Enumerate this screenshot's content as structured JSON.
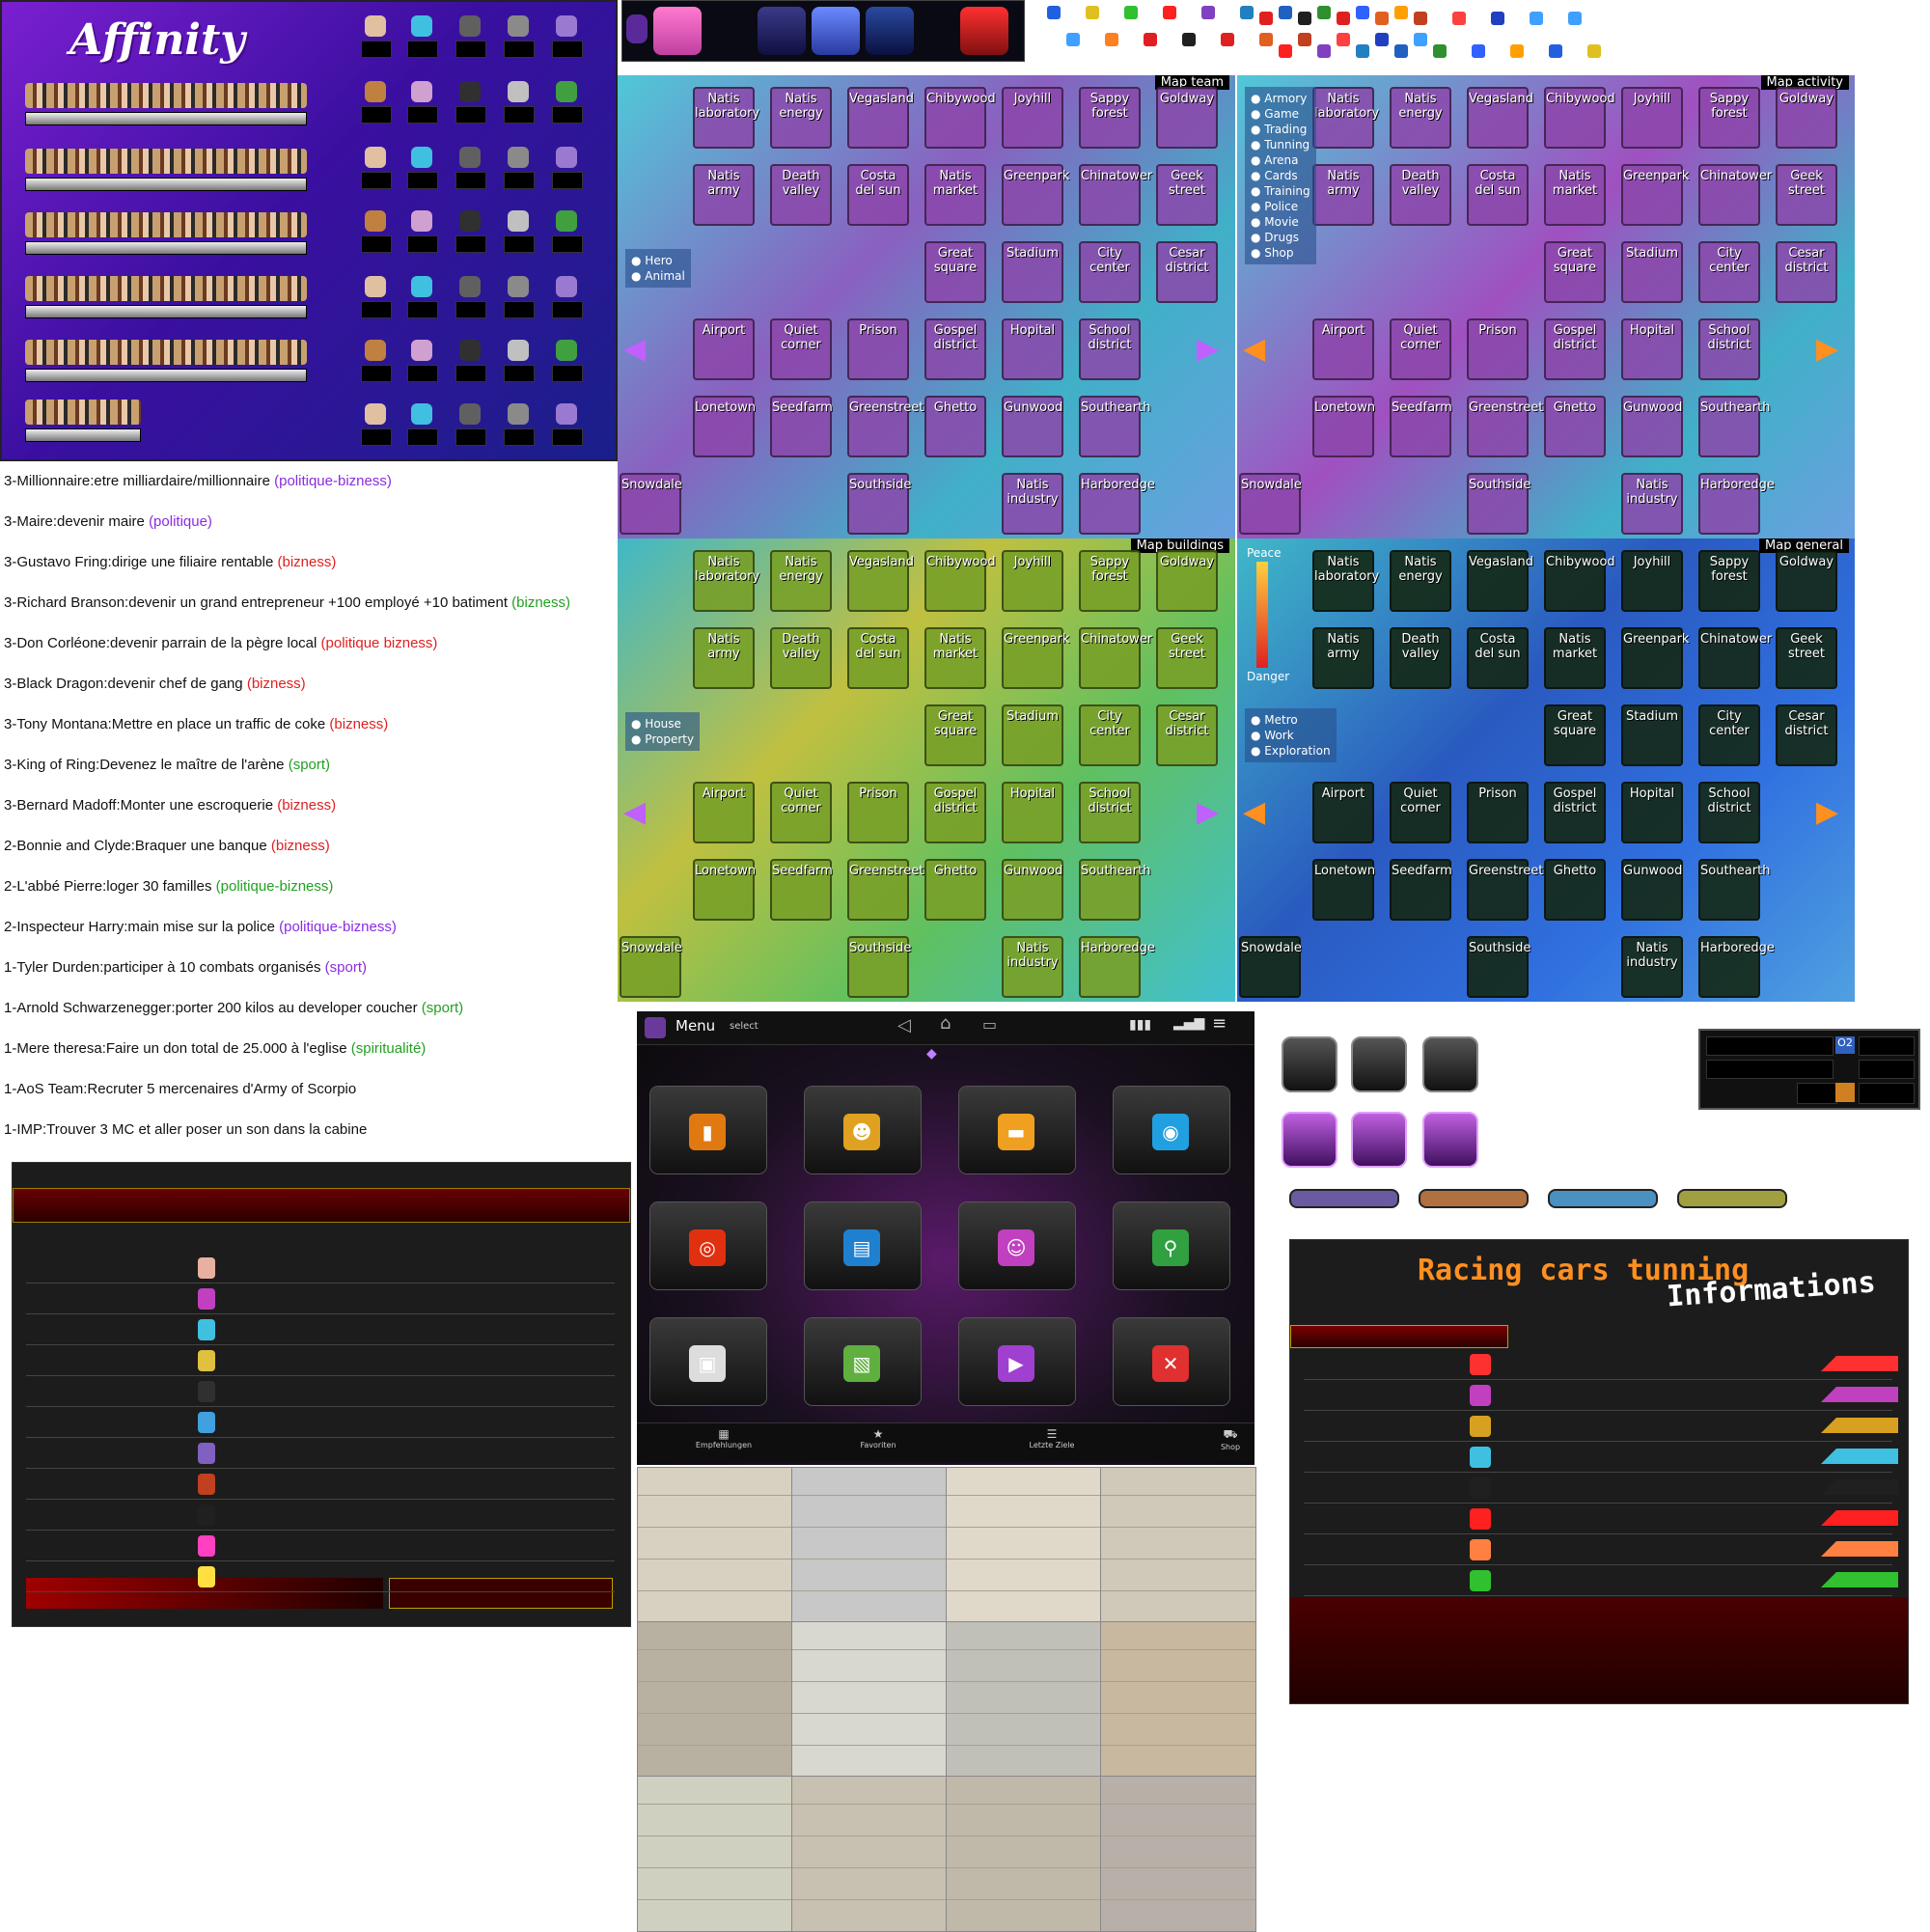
{
  "affinity": {
    "title": "Affinity"
  },
  "maps": [
    {
      "id": "team",
      "title": "Map team",
      "legend": [
        {
          "icon": "star-icon",
          "label": "Hero"
        },
        {
          "icon": "paw-icon",
          "label": "Animal"
        }
      ]
    },
    {
      "id": "activity",
      "title": "Map activity",
      "legend": [
        {
          "icon": "armory-icon",
          "label": "Armory"
        },
        {
          "icon": "gamepad-icon",
          "label": "Game"
        },
        {
          "icon": "dollar-icon",
          "label": "Trading"
        },
        {
          "icon": "gear-icon",
          "label": "Tunning"
        },
        {
          "icon": "arena-icon",
          "label": "Arena"
        },
        {
          "icon": "cards-icon",
          "label": "Cards"
        },
        {
          "icon": "training-icon",
          "label": "Training"
        },
        {
          "icon": "police-icon",
          "label": "Police"
        },
        {
          "icon": "movie-icon",
          "label": "Movie"
        },
        {
          "icon": "drugs-icon",
          "label": "Drugs"
        },
        {
          "icon": "shop-icon",
          "label": "Shop"
        }
      ]
    },
    {
      "id": "buildings",
      "title": "Map buildings",
      "legend": [
        {
          "icon": "house-icon",
          "label": "House"
        },
        {
          "icon": "dollar-icon",
          "label": "Property"
        }
      ]
    },
    {
      "id": "general",
      "title": "Map general",
      "legend": [
        {
          "icon": "star-icon",
          "label": "Metro"
        },
        {
          "icon": "work-icon",
          "label": "Work"
        },
        {
          "icon": "question-icon",
          "label": "Exploration"
        }
      ],
      "gauge": {
        "top": "Peace",
        "bottom": "Danger"
      }
    }
  ],
  "districts": [
    {
      "row": 0,
      "col": 0,
      "name": "Natis laboratory"
    },
    {
      "row": 0,
      "col": 1,
      "name": "Natis energy"
    },
    {
      "row": 0,
      "col": 2,
      "name": "Vegasland"
    },
    {
      "row": 0,
      "col": 3,
      "name": "Chibywood"
    },
    {
      "row": 0,
      "col": 4,
      "name": "Joyhill"
    },
    {
      "row": 0,
      "col": 5,
      "name": "Sappy forest"
    },
    {
      "row": 0,
      "col": 6,
      "name": "Goldway"
    },
    {
      "row": 1,
      "col": 0,
      "name": "Natis army"
    },
    {
      "row": 1,
      "col": 1,
      "name": "Death valley"
    },
    {
      "row": 1,
      "col": 2,
      "name": "Costa del sun"
    },
    {
      "row": 1,
      "col": 3,
      "name": "Natis market"
    },
    {
      "row": 1,
      "col": 4,
      "name": "Greenpark"
    },
    {
      "row": 1,
      "col": 5,
      "name": "Chinatower"
    },
    {
      "row": 1,
      "col": 6,
      "name": "Geek street"
    },
    {
      "row": 2,
      "col": 3,
      "name": "Great square"
    },
    {
      "row": 2,
      "col": 4,
      "name": "Stadium"
    },
    {
      "row": 2,
      "col": 5,
      "name": "City center"
    },
    {
      "row": 2,
      "col": 6,
      "name": "Cesar district"
    },
    {
      "row": 3,
      "col": 0,
      "name": "Airport"
    },
    {
      "row": 3,
      "col": 1,
      "name": "Quiet corner"
    },
    {
      "row": 3,
      "col": 2,
      "name": "Prison"
    },
    {
      "row": 3,
      "col": 3,
      "name": "Gospel district"
    },
    {
      "row": 3,
      "col": 4,
      "name": "Hopital"
    },
    {
      "row": 3,
      "col": 5,
      "name": "School district"
    },
    {
      "row": 4,
      "col": 0,
      "name": "Lonetown"
    },
    {
      "row": 4,
      "col": 1,
      "name": "Seedfarm"
    },
    {
      "row": 4,
      "col": 2,
      "name": "Greenstreet"
    },
    {
      "row": 4,
      "col": 3,
      "name": "Ghetto"
    },
    {
      "row": 4,
      "col": 4,
      "name": "Gunwood"
    },
    {
      "row": 4,
      "col": 5,
      "name": "Southearth"
    },
    {
      "row": 5,
      "col": -1,
      "name": "Snowdale"
    },
    {
      "row": 5,
      "col": 2,
      "name": "Southside"
    },
    {
      "row": 5,
      "col": 4,
      "name": "Natis industry"
    },
    {
      "row": 5,
      "col": 5,
      "name": "Harboredge"
    }
  ],
  "goals": [
    {
      "text": "3-Millionnaire:etre milliardaire/millionnaire ",
      "tag": "(politique-bizness)",
      "color": "#8a2be2"
    },
    {
      "text": "3-Maire:devenir maire ",
      "tag": "(politique)",
      "color": "#8a2be2"
    },
    {
      "text": "3-Gustavo Fring:dirige une filiaire rentable ",
      "tag": "(bizness)",
      "color": "#e02020"
    },
    {
      "text": "3-Richard Branson:devenir un grand entrepreneur +100 employé +10 batiment ",
      "tag": "(bizness)",
      "color": "#22a022"
    },
    {
      "text": "3-Don Corléone:devenir parrain de la pègre local ",
      "tag": "(politique bizness)",
      "color": "#e02020"
    },
    {
      "text": "3-Black Dragon:devenir chef de gang ",
      "tag": "(bizness)",
      "color": "#e02020"
    },
    {
      "text": "3-Tony Montana:Mettre en place un traffic de coke ",
      "tag": "(bizness)",
      "color": "#e02020"
    },
    {
      "text": "3-King of Ring:Devenez le maître de l'arène ",
      "tag": "(sport)",
      "color": "#22a022"
    },
    {
      "text": "3-Bernard Madoff:Monter une escroquerie ",
      "tag": "(bizness)",
      "color": "#e02020"
    },
    {
      "text": "2-Bonnie and Clyde:Braquer une banque ",
      "tag": "(bizness)",
      "color": "#e02020"
    },
    {
      "text": "2-L'abbé Pierre:loger 30 familles ",
      "tag": "(politique-bizness)",
      "color": "#22a022"
    },
    {
      "text": "2-Inspecteur Harry:main mise sur la police ",
      "tag": "(politique-bizness)",
      "color": "#8a2be2"
    },
    {
      "text": "1-Tyler Durden:participer à 10 combats organisés ",
      "tag": "(sport)",
      "color": "#8a2be2"
    },
    {
      "text": "1-Arnold  Schwarzenegger:porter 200 kilos au developer coucher ",
      "tag": "(sport)",
      "color": "#22a022"
    },
    {
      "text": "1-Mere theresa:Faire un don total de 25.000 à l'eglise ",
      "tag": "(spiritualité)",
      "color": "#22a022"
    },
    {
      "text": "1-AoS Team:Recruter 5 mercenaires d'Army of Scorpio",
      "tag": "",
      "color": "#22a022"
    },
    {
      "text": "1-IMP:Trouver 3 MC et aller poser un son dans la cabine",
      "tag": "",
      "color": "#22a022"
    }
  ],
  "tablet": {
    "menu_label": "Menu",
    "menu_sub": "select",
    "tiles": [
      {
        "icon": "bars-icon",
        "color": "#e07a10",
        "glyph": "▮"
      },
      {
        "icon": "person-icon",
        "color": "#e0a020",
        "glyph": "☻"
      },
      {
        "icon": "gun-icon",
        "color": "#f0a020",
        "glyph": "▬"
      },
      {
        "icon": "eye-icon",
        "color": "#20a0e0",
        "glyph": "◉"
      },
      {
        "icon": "target-icon",
        "color": "#e03010",
        "glyph": "◎"
      },
      {
        "icon": "document-icon",
        "color": "#2080d0",
        "glyph": "▤"
      },
      {
        "icon": "users-icon",
        "color": "#c040c0",
        "glyph": "☺"
      },
      {
        "icon": "search-icon",
        "color": "#30a040",
        "glyph": "⚲"
      },
      {
        "icon": "contact-icon",
        "color": "#dddddd",
        "glyph": "▣"
      },
      {
        "icon": "monitor-icon",
        "color": "#60b040",
        "glyph": "▧"
      },
      {
        "icon": "video-icon",
        "color": "#a040d0",
        "glyph": "▶"
      },
      {
        "icon": "close-icon",
        "color": "#e03030",
        "glyph": "✕"
      }
    ],
    "bottom_tabs": [
      "Empfehlungen",
      "Favoriten",
      "Letzte Ziele",
      "Shop"
    ]
  },
  "racing": {
    "title1": "Racing cars tunning",
    "title2": "Informations",
    "stripes": [
      "#ff3030",
      "#ffff00",
      "#30c030",
      "#e080ff",
      "#d8a020",
      "#40d0ff",
      "#ff2020",
      "#ff3030",
      "#ff8040",
      "#30c030"
    ]
  },
  "gauge_labels": {
    "o2": "O2"
  }
}
